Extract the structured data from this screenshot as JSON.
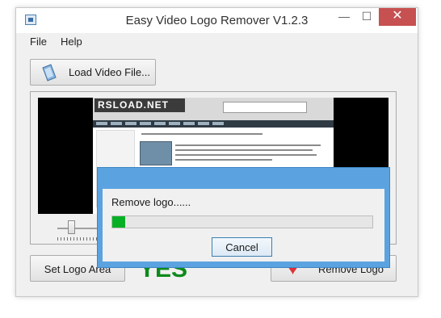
{
  "window": {
    "title": "Easy Video Logo Remover V1.2.3",
    "minimize_label": "—",
    "maximize_label": "☐",
    "close_label": "✕"
  },
  "menu": {
    "items": [
      {
        "label": "File"
      },
      {
        "label": "Help"
      }
    ]
  },
  "toolbar": {
    "load_label": "Load Video File...",
    "load_icon": "video-file-icon"
  },
  "preview": {
    "site_logo": "RSLOAD.NET",
    "slider_position": 0.2
  },
  "actions": {
    "set_logo_label": "Set Logo Area",
    "status_text": "YES",
    "status_color": "#0c8a1c",
    "remove_label": "Remove Logo",
    "remove_icon": "heart-icon"
  },
  "dialog": {
    "message": "Remove logo......",
    "progress": 0.05,
    "progress_color": "#06b025",
    "cancel_label": "Cancel",
    "accent": "#5aa3e0"
  }
}
